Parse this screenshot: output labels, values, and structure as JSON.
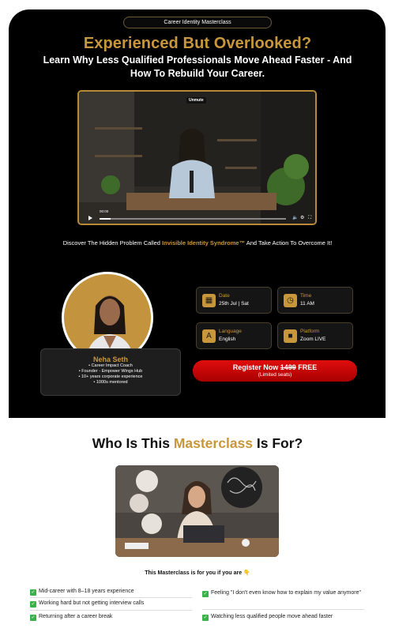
{
  "hero": {
    "pill": "Career Identity Masterclass",
    "title": "Experienced But Overlooked?",
    "subtitle": "Learn Why Less Qualified Professionals Move Ahead Faster - And How To Rebuild Your Career."
  },
  "video": {
    "unmute_label": "Unmute",
    "time": "00:00",
    "progress": 0.06
  },
  "discover": {
    "before": "Discover The Hidden Problem Called ",
    "highlight": "Invisible Identity Syndrome™",
    "after": " And Take Action To Overcome It!"
  },
  "speaker": {
    "name": "Neha Seth",
    "lines": [
      "• Career Impact Coach",
      "• Founder - Empower Wings Hub",
      "• 10+ years corporate experience",
      "• 1000s mentored"
    ]
  },
  "details": {
    "date": {
      "label": "Date",
      "value": "25th Jul | Sat",
      "icon": "calendar-icon"
    },
    "time": {
      "label": "Time",
      "value": "11 AM",
      "icon": "clock-icon"
    },
    "language": {
      "label": "Language",
      "value": "English",
      "icon": "language-icon"
    },
    "platform": {
      "label": "Platform",
      "value": "Zoom LIVE",
      "icon": "video-camera-icon"
    }
  },
  "register": {
    "prefix": "Register Now ",
    "old_price": "1499",
    "suffix": " FREE",
    "note": "(Limited seats)"
  },
  "audience": {
    "title_before": "Who Is This ",
    "title_highlight": "Masterclass",
    "title_after": " Is For?",
    "for_you": "This Masterclass is for you if you are 👇",
    "left": [
      "Mid-career with 8–18 years experience",
      "Working hard but not getting interview calls",
      "Returning after a career break"
    ],
    "right": [
      "Feeling \"I don't even know how to explain my value anymore\"",
      "Watching less qualified people move ahead faster"
    ]
  },
  "colors": {
    "gold": "#c9973b",
    "register_red": "#d80808",
    "check_green": "#3bb14a"
  }
}
